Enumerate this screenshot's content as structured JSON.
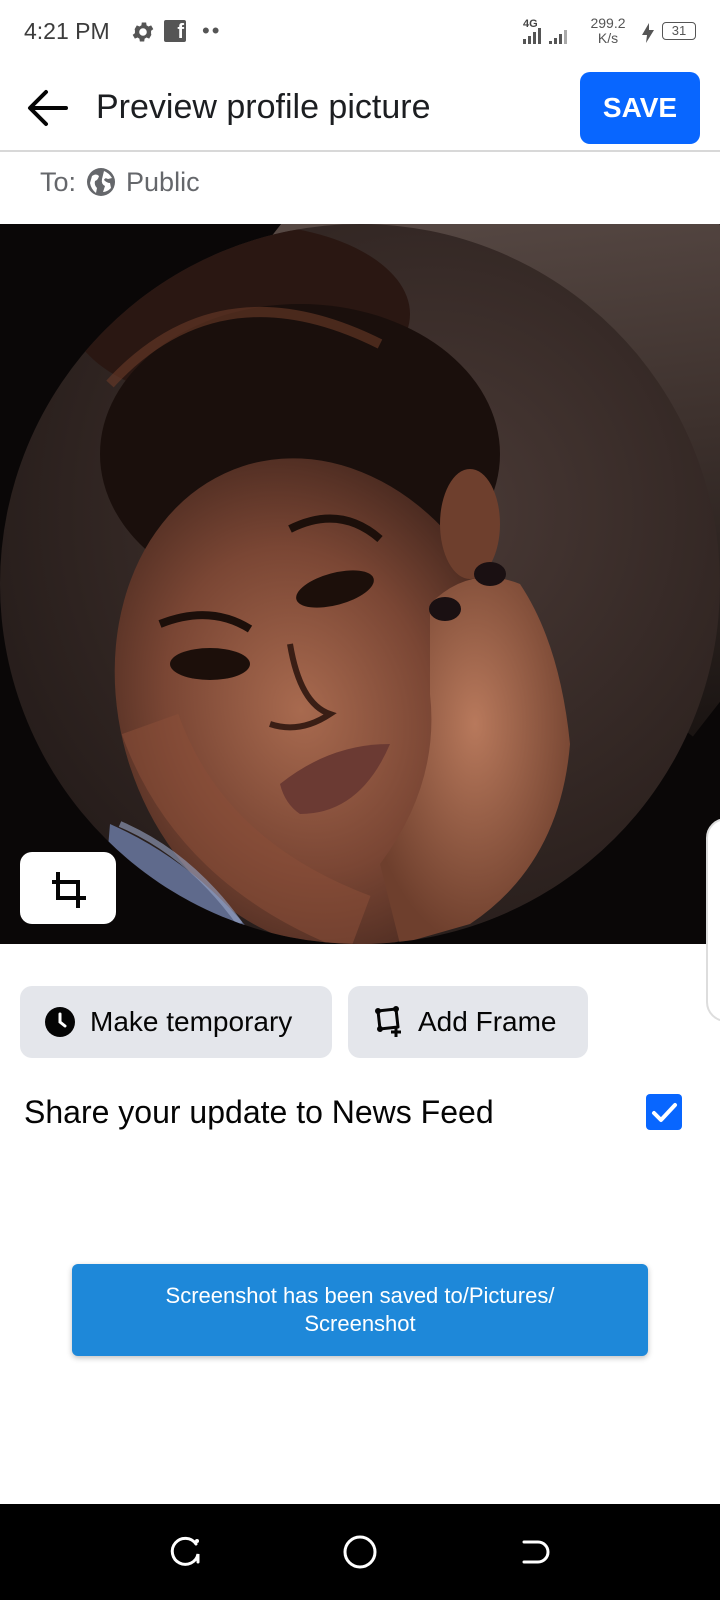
{
  "status_bar": {
    "time": "4:21 PM",
    "network_type": "4G",
    "speed_value": "299.2",
    "speed_unit": "K/s",
    "battery_level": "31",
    "icons": [
      "gear-icon",
      "facebook-icon",
      "dots-icon",
      "signal-icon",
      "charging-icon",
      "battery-icon"
    ]
  },
  "header": {
    "title": "Preview profile picture",
    "save_label": "SAVE",
    "back_icon": "arrow-left-icon"
  },
  "audience": {
    "prefix": "To:",
    "value": "Public",
    "icon": "globe-icon"
  },
  "photo": {
    "crop_icon": "crop-icon"
  },
  "actions": {
    "make_temporary_label": "Make temporary",
    "make_temporary_icon": "clock-icon",
    "add_frame_label": "Add Frame",
    "add_frame_icon": "frame-icon"
  },
  "share": {
    "label": "Share your update to News Feed",
    "checked": true
  },
  "toast": {
    "line1": "Screenshot has been saved to/Pictures/",
    "line2": "Screenshot"
  },
  "nav_bar": {
    "icons": [
      "recent-apps-icon",
      "home-icon",
      "back-nav-icon"
    ]
  },
  "colors": {
    "accent": "#0866ff",
    "toast": "#1e88d9",
    "chip_bg": "#e4e6eb",
    "text_secondary": "#65676b"
  }
}
